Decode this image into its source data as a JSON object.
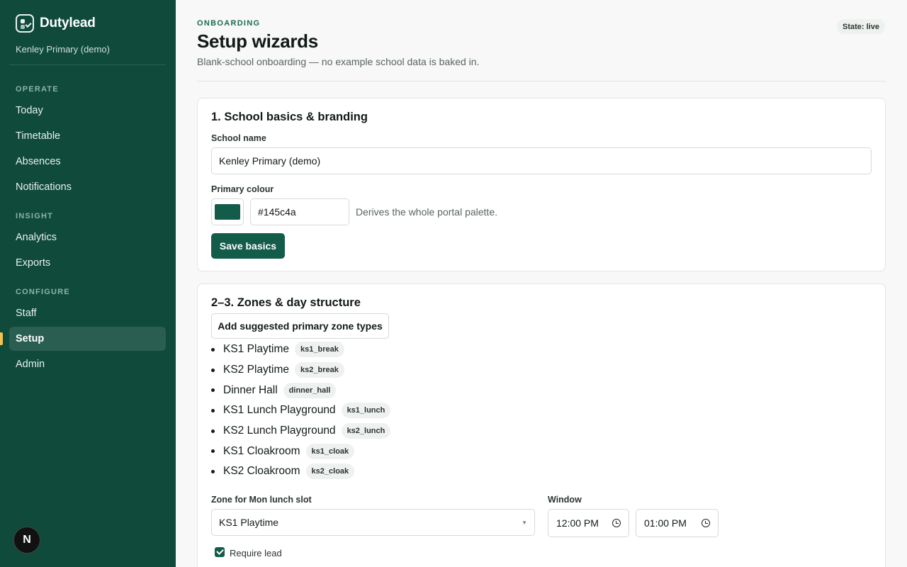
{
  "brand": {
    "name": "Dutylead"
  },
  "school_name": "Kenley Primary (demo)",
  "nav": {
    "sections": [
      {
        "label": "OPERATE",
        "items": [
          "Today",
          "Timetable",
          "Absences",
          "Notifications"
        ]
      },
      {
        "label": "INSIGHT",
        "items": [
          "Analytics",
          "Exports"
        ]
      },
      {
        "label": "CONFIGURE",
        "items": [
          "Staff",
          "Setup",
          "Admin"
        ]
      }
    ],
    "active": "Setup"
  },
  "footer_badge": "N",
  "header": {
    "eyebrow": "ONBOARDING",
    "title": "Setup wizards",
    "subtitle": "Blank-school onboarding — no example school data is baked in.",
    "state": "State: live"
  },
  "basics": {
    "title": "1. School basics & branding",
    "school_name_label": "School name",
    "school_name_value": "Kenley Primary (demo)",
    "colour_label": "Primary colour",
    "colour_value": "#145c4a",
    "colour_hint": "Derives the whole portal palette.",
    "save_label": "Save basics"
  },
  "zones": {
    "title": "2–3. Zones & day structure",
    "add_suggested_label": "Add suggested primary zone types",
    "items": [
      {
        "name": "KS1 Playtime",
        "code": "ks1_break"
      },
      {
        "name": "KS2 Playtime",
        "code": "ks2_break"
      },
      {
        "name": "Dinner Hall",
        "code": "dinner_hall"
      },
      {
        "name": "KS1 Lunch Playground",
        "code": "ks1_lunch"
      },
      {
        "name": "KS2 Lunch Playground",
        "code": "ks2_lunch"
      },
      {
        "name": "KS1 Cloakroom",
        "code": "ks1_cloak"
      },
      {
        "name": "KS2 Cloakroom",
        "code": "ks2_cloak"
      }
    ],
    "slot_zone_label": "Zone for Mon lunch slot",
    "slot_zone_value": "KS1 Playtime",
    "window_label": "Window",
    "window_start": "12:00 PM",
    "window_end": "01:00 PM",
    "require_lead_label": "Require lead",
    "require_lead_checked": true
  }
}
